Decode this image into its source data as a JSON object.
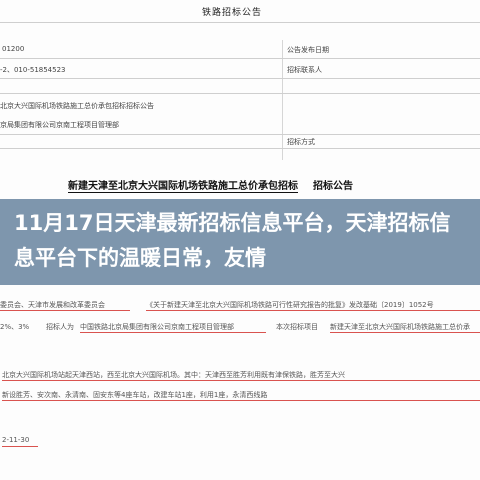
{
  "document": {
    "header_title": "铁路招标公告",
    "table_rows": [
      {
        "left": "01200",
        "right": "公告发布日期"
      },
      {
        "left": "-2、010-51854523",
        "right": "招标联系人"
      },
      {
        "left": "北京大兴国际机场铁路施工总价承包招标招标公告",
        "right": ""
      },
      {
        "left": "京局集团有限公司京南工程项目管理部",
        "right": ""
      },
      {
        "left": "",
        "right": "招标方式"
      }
    ],
    "notice_title_part1": "新建天津至北京大兴国际机场铁路施工总价承包招标",
    "notice_title_part2": "招标公告",
    "body_lines": [
      "委员会、天津市发展和改革委员会",
      "《关于新建天津至北京大兴国际机场铁路可行性研究报告的批复》发改基础〔2019〕1052号",
      "2%、3%",
      "招标人为",
      "中国铁路北京局集团有限公司京南工程项目管理部",
      "本次招标项目",
      "新建天津至北京大兴国际机场铁路施工总价承",
      "北京大兴国际机场站起天津西站，西至北京大兴国际机场。其中：天津西至胜芳利用既有津保铁路，胜芳至大兴",
      "新设胜芳、安次南、永清南、固安东等4座车站，改建车站1座，利用1座，永清西线路",
      "2-11-30"
    ]
  },
  "overlay": {
    "title": "11月17日天津最新招标信息平台，天津招标信息平台下的温暖日常，友情"
  }
}
